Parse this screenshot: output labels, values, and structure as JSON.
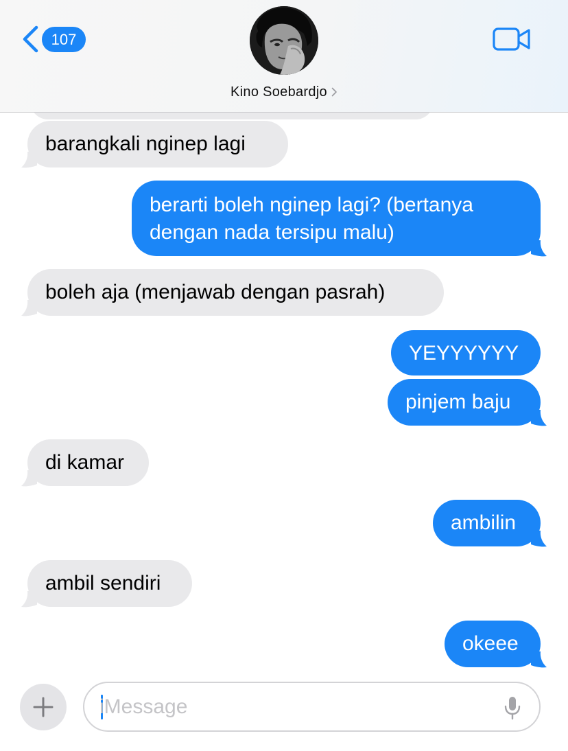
{
  "header": {
    "back_count": "107",
    "contact_name": "Kino Soebardjo",
    "icons": [
      "chevron-left-icon",
      "avatar",
      "chevron-right-icon",
      "video-camera-icon"
    ]
  },
  "messages": [
    {
      "sender": "contact",
      "text": ""
    },
    {
      "sender": "contact",
      "text": "barangkali nginep lagi"
    },
    {
      "sender": "me",
      "text": "berarti boleh nginep lagi? (bertanya",
      "text_line2": "dengan nada tersipu malu)"
    },
    {
      "sender": "contact",
      "text": "boleh aja (menjawab dengan pasrah)"
    },
    {
      "sender": "me",
      "text": "YEYYYYYY"
    },
    {
      "sender": "me",
      "text": "pinjem baju"
    },
    {
      "sender": "contact",
      "text": "di kamar"
    },
    {
      "sender": "me",
      "text": "ambilin"
    },
    {
      "sender": "contact",
      "text": "ambil sendiri"
    },
    {
      "sender": "me",
      "text": "okeee"
    }
  ],
  "composer": {
    "placeholder": "iMessage",
    "icons": [
      "plus-icon",
      "microphone-icon"
    ]
  },
  "colors": {
    "accent_blue": "#1b86f7",
    "incoming_bubble": "#e9e9eb",
    "header_bg": "#f6f6f6"
  }
}
